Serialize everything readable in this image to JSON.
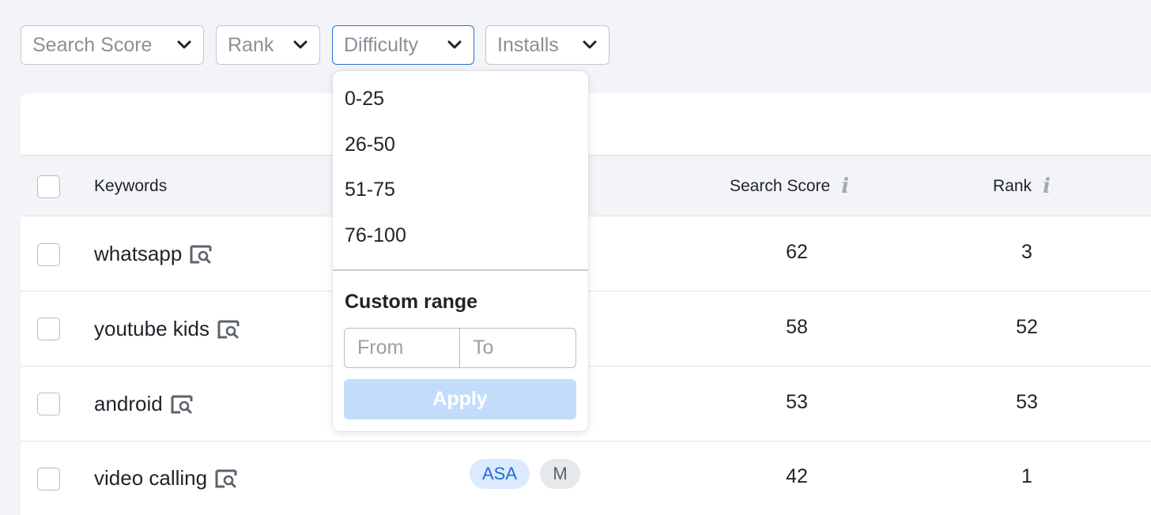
{
  "filters": [
    {
      "label": "Search Score",
      "active": false
    },
    {
      "label": "Rank",
      "active": false
    },
    {
      "label": "Difficulty",
      "active": true
    },
    {
      "label": "Installs",
      "active": false
    }
  ],
  "table": {
    "headers": {
      "keywords": "Keywords",
      "search_score": "Search Score",
      "rank": "Rank"
    },
    "rows": [
      {
        "keyword": "whatsapp",
        "search_score": "62",
        "rank": "3",
        "tags": []
      },
      {
        "keyword": "youtube kids",
        "search_score": "58",
        "rank": "52",
        "tags": []
      },
      {
        "keyword": "android",
        "search_score": "53",
        "rank": "53",
        "tags": []
      },
      {
        "keyword": "video calling",
        "search_score": "42",
        "rank": "1",
        "tags": [
          "ASA",
          "M"
        ]
      }
    ]
  },
  "difficulty_dropdown": {
    "options": [
      "0-25",
      "26-50",
      "51-75",
      "76-100"
    ],
    "custom_range_title": "Custom range",
    "from_placeholder": "From",
    "to_placeholder": "To",
    "apply_label": "Apply"
  },
  "colors": {
    "active_border": "#2b6fd6",
    "asa_tag_bg": "#dbeafe",
    "asa_tag_text": "#1f6fd0",
    "apply_disabled_bg": "#c3dcfb"
  },
  "icons": {
    "dropdown_chevron": "chevron-down-icon",
    "keyword_lookup": "keyword-search-icon",
    "column_info": "info-icon"
  }
}
